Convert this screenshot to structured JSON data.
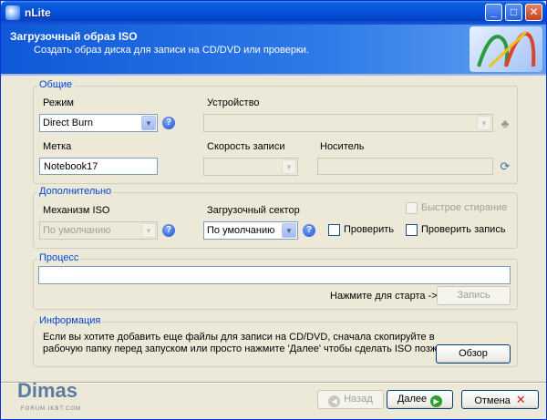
{
  "window": {
    "title": "nLite",
    "minimize_glyph": "_",
    "maximize_glyph": "□",
    "close_glyph": "✕"
  },
  "header": {
    "title": "Загрузочный образ ISO",
    "subtitle": "Создать образ диска для записи на CD/DVD или проверки.",
    "logo_icon": "nlite-logo-icon"
  },
  "general": {
    "legend": "Общие",
    "mode_label": "Режим",
    "mode_value": "Direct Burn",
    "device_label": "Устройство",
    "device_value": "",
    "label_label": "Метка",
    "label_value": "Notebook17",
    "speed_label": "Скорость записи",
    "speed_value": "",
    "media_label": "Носитель",
    "media_value": ""
  },
  "advanced": {
    "legend": "Дополнительно",
    "iso_engine_label": "Механизм ISO",
    "iso_engine_value": "По умолчанию",
    "boot_sector_label": "Загрузочный сектор",
    "boot_sector_value": "По умолчанию",
    "quick_erase_label": "Быстрое стирание",
    "verify_label": "Проверить",
    "verify_write_label": "Проверить запись"
  },
  "process": {
    "legend": "Процесс",
    "start_hint": "Нажмите для старта ->",
    "write_button": "Запись"
  },
  "info": {
    "legend": "Информация",
    "text_line1": "Если вы хотите добавить еще файлы для записи на CD/DVD, сначала скопируйте в",
    "text_line2": "рабочую папку перед запуском или просто нажмите 'Далее' чтобы сделать ISO позже.",
    "browse_button": "Обзор"
  },
  "footer": {
    "back_button": "Назад",
    "next_button": "Далее",
    "cancel_button": "Отмена",
    "watermark_main": "Dimas",
    "watermark_sub": "FORUM.IKBT.COM"
  },
  "icons": {
    "help": "?",
    "dropdown": "▼",
    "device_side": "♣",
    "refresh": "⟳",
    "back_arrow": "◀",
    "next_arrow": "▶",
    "cancel_x": "✕"
  },
  "colors": {
    "title_bar": "#0553da",
    "legend_text": "#0046d5",
    "next_icon": "#2f9e2f",
    "cancel_icon": "#cc2222"
  }
}
